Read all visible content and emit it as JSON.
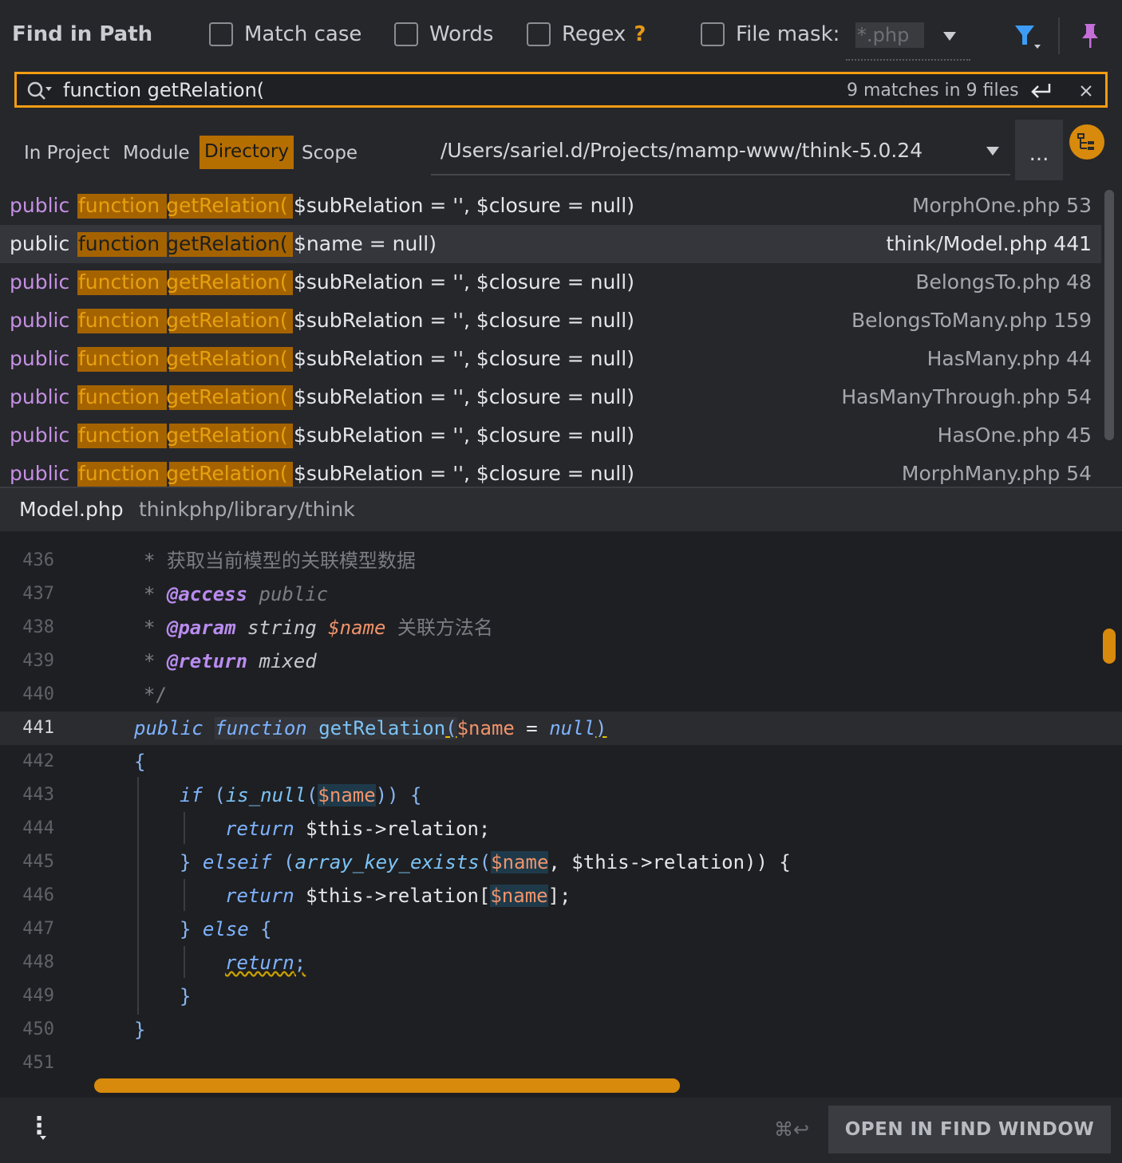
{
  "header": {
    "title": "Find in Path",
    "options": {
      "match_case": "Match case",
      "words": "Words",
      "regex": "Regex",
      "regex_help": "?",
      "file_mask": "File mask:"
    },
    "file_mask_value": "*.php"
  },
  "search": {
    "query": "function getRelation(",
    "match_summary": "9 matches in 9 files"
  },
  "scope": {
    "tabs": [
      "In Project",
      "Module",
      "Directory",
      "Scope"
    ],
    "active_tab": "Directory",
    "directory_path": "/Users/sariel.d/Projects/mamp-www/think-5.0.24",
    "more_label": "..."
  },
  "results": [
    {
      "keyword": "public",
      "match": "function getRelation(",
      "args": "$subRelation = '', $closure = null)",
      "file": "MorphOne.php 53"
    },
    {
      "keyword": "public",
      "match": "function getRelation(",
      "args": "$name = null)",
      "file": "think/Model.php 441",
      "selected": true
    },
    {
      "keyword": "public",
      "match": "function getRelation(",
      "args": "$subRelation = '', $closure = null)",
      "file": "BelongsTo.php 48"
    },
    {
      "keyword": "public",
      "match": "function getRelation(",
      "args": "$subRelation = '', $closure = null)",
      "file": "BelongsToMany.php 159"
    },
    {
      "keyword": "public",
      "match": "function getRelation(",
      "args": "$subRelation = '', $closure = null)",
      "file": "HasMany.php 44"
    },
    {
      "keyword": "public",
      "match": "function getRelation(",
      "args": "$subRelation = '', $closure = null)",
      "file": "HasManyThrough.php 54"
    },
    {
      "keyword": "public",
      "match": "function getRelation(",
      "args": "$subRelation = '', $closure = null)",
      "file": "HasOne.php 45"
    },
    {
      "keyword": "public",
      "match": "function getRelation(",
      "args": "$subRelation = '', $closure = null)",
      "file": "MorphMany.php 54"
    }
  ],
  "preview": {
    "file_name": "Model.php",
    "file_dir": "thinkphp/library/think",
    "line_numbers": [
      "436",
      "437",
      "438",
      "439",
      "440",
      "441",
      "442",
      "443",
      "444",
      "445",
      "446",
      "447",
      "448",
      "449",
      "450",
      "451"
    ],
    "current_line": "441",
    "code": {
      "l436": "* 获取当前模型的关联模型数据",
      "l437_star": "* ",
      "l437_tag": "@access",
      "l437_rest": " public",
      "l438_star": "* ",
      "l438_tag": "@param",
      "l438_type": " string ",
      "l438_var": "$name",
      "l438_desc": " 关联方法名",
      "l439_star": "* ",
      "l439_tag": "@return",
      "l439_rest": " mixed",
      "l440": "*/",
      "l441_public": "public",
      "l441_function": "function",
      "l441_name": "getRelation",
      "l441_open": "(",
      "l441_var": "$name",
      "l441_eq": " = ",
      "l441_null": "null",
      "l441_close": ")",
      "l442": "{",
      "l443_if": "if",
      "l443_open": " (",
      "l443_fn": "is_null",
      "l443_p": "(",
      "l443_var": "$name",
      "l443_end": ")) {",
      "l444_ret": "return",
      "l444_rest": " $this->relation;",
      "l445_close": "} ",
      "l445_elseif": "elseif",
      "l445_open": " (",
      "l445_fn": "array_key_exists",
      "l445_p": "(",
      "l445_var": "$name",
      "l445_rest": ", $this->relation)) {",
      "l446_ret": "return",
      "l446_rest": " $this->relation[",
      "l446_var": "$name",
      "l446_end": "];",
      "l447_close": "} ",
      "l447_else": "else",
      "l447_rest": " {",
      "l448_ret": "return",
      "l448_end": ";",
      "l449": "}",
      "l450": "}"
    }
  },
  "footer": {
    "shortcut": "⌘↩",
    "open_button": "OPEN IN FIND WINDOW",
    "menu_icon": "⋮"
  },
  "colors": {
    "accent": "#f39c12",
    "match_highlight": "#a56300",
    "keyword_purple": "#c58fe4",
    "background": "#26272b"
  }
}
